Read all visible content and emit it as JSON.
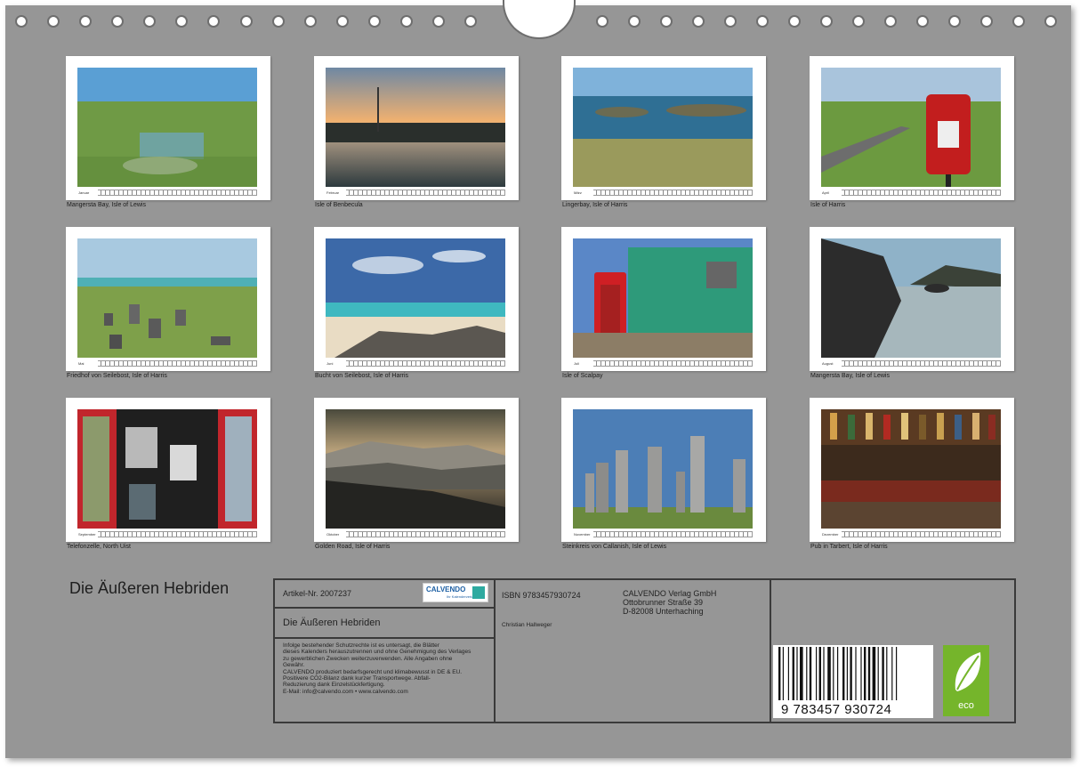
{
  "calendar": {
    "title": "Die Äußeren Hebriden",
    "months": [
      {
        "month": "Januar",
        "caption": "Mangersta Bay, Isle of Lewis"
      },
      {
        "month": "Februar",
        "caption": "Isle of Benbecula"
      },
      {
        "month": "März",
        "caption": "Lingerbay, Isle of Harris"
      },
      {
        "month": "April",
        "caption": "Isle of Harris"
      },
      {
        "month": "Mai",
        "caption": "Friedhof von Seilebost, Isle of Harris"
      },
      {
        "month": "Juni",
        "caption": "Bucht von Seilebost, Isle of Harris"
      },
      {
        "month": "Juli",
        "caption": "Isle of Scalpay"
      },
      {
        "month": "August",
        "caption": "Mangersta Bay, Isle of Lewis"
      },
      {
        "month": "September",
        "caption": "Telefonzelle, North Uist"
      },
      {
        "month": "Oktober",
        "caption": "Golden Road, Isle of Harris"
      },
      {
        "month": "November",
        "caption": "Steinkreis von Callanish, Isle of Lewis"
      },
      {
        "month": "Dezember",
        "caption": "Pub in Tarbert, Isle of Harris"
      }
    ]
  },
  "imprint": {
    "article": "Artikel-Nr. 2007237",
    "title": "Die Äußeren Hebriden",
    "legal": [
      "Infolge bestehender Schutzrechte ist es untersagt, die Blätter",
      "dieses Kalenders herauszutrennen und ohne Genehmigung des Verlages",
      "zu gewerblichen Zwecken weiterzuverwenden. Alle Angaben ohne",
      "Gewähr.",
      "CALVENDO produziert bedarfsgerecht und klimabewusst in DE & EU.",
      "Positivere CO2-Bilanz dank kurzer Transportwege. Abfall-",
      "Reduzierung dank Einzelstückfertigung.",
      "E-Mail: info@calvendo.com • www.calvendo.com"
    ],
    "isbn": "ISBN 9783457930724",
    "author": "Christian Hallweger",
    "publisher": [
      "CALVENDO Verlag GmbH",
      "Ottobrunner Straße 39",
      "D-82008 Unterhaching"
    ],
    "logo_text": "CALVENDO",
    "logo_sub": "Ihr Kalenderverlag",
    "barcode_number": "9 783457 930724",
    "eco_label": "eco"
  },
  "colors": {
    "sheet": "#969696",
    "eco": "#75b52b",
    "logo": "#1d5fa3"
  }
}
